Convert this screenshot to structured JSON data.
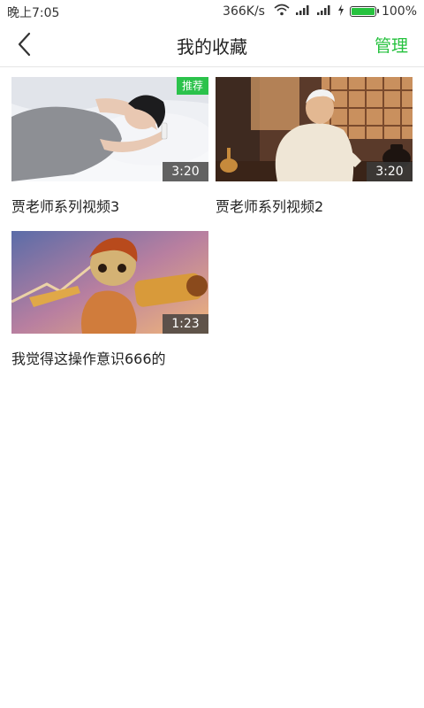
{
  "status_bar": {
    "time": "晚上7:05",
    "speed": "366K/s",
    "battery_percent": "100%",
    "battery_level": 1.0
  },
  "header": {
    "title": "我的收藏",
    "manage_label": "管理"
  },
  "videos": [
    {
      "title": "贾老师系列视频3",
      "duration": "3:20",
      "badge": "推荐"
    },
    {
      "title": "贾老师系列视频2",
      "duration": "3:20"
    },
    {
      "title": "我觉得这操作意识666的",
      "duration": "1:23"
    }
  ],
  "colors": {
    "accent": "#26c23e",
    "badge_bg": "#2bc24b"
  },
  "icons": {
    "back": "chevron-left-icon",
    "wifi": "wifi-icon",
    "signal": "signal-icon",
    "charging": "charging-icon",
    "battery": "battery-icon"
  }
}
